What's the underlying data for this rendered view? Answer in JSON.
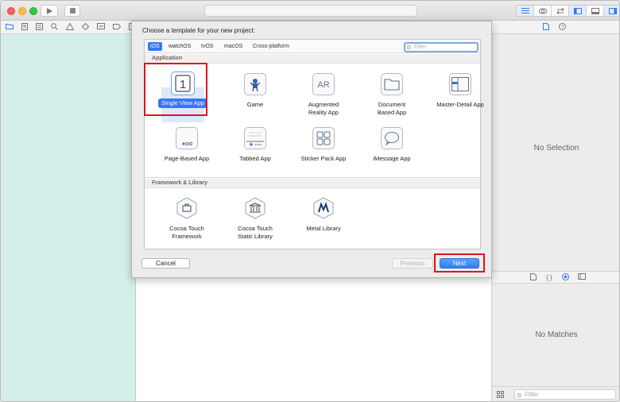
{
  "app": {
    "activity_text": "",
    "icons": {
      "run": "play-icon",
      "stop": "stop-icon"
    }
  },
  "navigator_tabs": [
    "folder-icon",
    "source-control-icon",
    "hierarchy-icon",
    "search-icon",
    "warning-icon",
    "test-icon",
    "debug-icon",
    "breakpoint-icon",
    "report-icon"
  ],
  "inspector": {
    "no_selection": "No Selection"
  },
  "library": {
    "no_matches": "No Matches",
    "filter_placeholder": "Filter"
  },
  "sheet": {
    "title": "Choose a template for your new project:",
    "platforms": [
      "iOS",
      "watchOS",
      "tvOS",
      "macOS",
      "Cross-platform"
    ],
    "selected_platform": "iOS",
    "filter_placeholder": "Filter",
    "sections": [
      {
        "name": "Application",
        "templates": [
          {
            "label": "Single View App",
            "icon": "single-view-icon",
            "glyph": "1",
            "selected": true
          },
          {
            "label": "Game",
            "icon": "game-icon",
            "glyph": ""
          },
          {
            "label": "Augmented\nReality App",
            "icon": "ar-icon",
            "glyph": "AR"
          },
          {
            "label": "Document\nBased App",
            "icon": "document-icon",
            "glyph": ""
          },
          {
            "label": "Master-Detail App",
            "icon": "master-detail-icon",
            "glyph": ""
          },
          {
            "label": "Page-Based App",
            "icon": "page-based-icon",
            "glyph": ""
          },
          {
            "label": "Tabbed App",
            "icon": "tabbed-icon",
            "glyph": ""
          },
          {
            "label": "Sticker Pack App",
            "icon": "sticker-pack-icon",
            "glyph": ""
          },
          {
            "label": "iMessage App",
            "icon": "imessage-icon",
            "glyph": ""
          }
        ]
      },
      {
        "name": "Framework & Library",
        "templates": [
          {
            "label": "Cocoa Touch\nFramework",
            "icon": "framework-icon"
          },
          {
            "label": "Cocoa Touch\nStatic Library",
            "icon": "static-library-icon"
          },
          {
            "label": "Metal Library",
            "icon": "metal-icon"
          }
        ]
      }
    ],
    "buttons": {
      "cancel": "Cancel",
      "previous": "Previous",
      "next": "Next"
    }
  },
  "colors": {
    "accent": "#3478f6",
    "highlight": "#e0121b",
    "navigator_bg": "#d4eee9"
  }
}
